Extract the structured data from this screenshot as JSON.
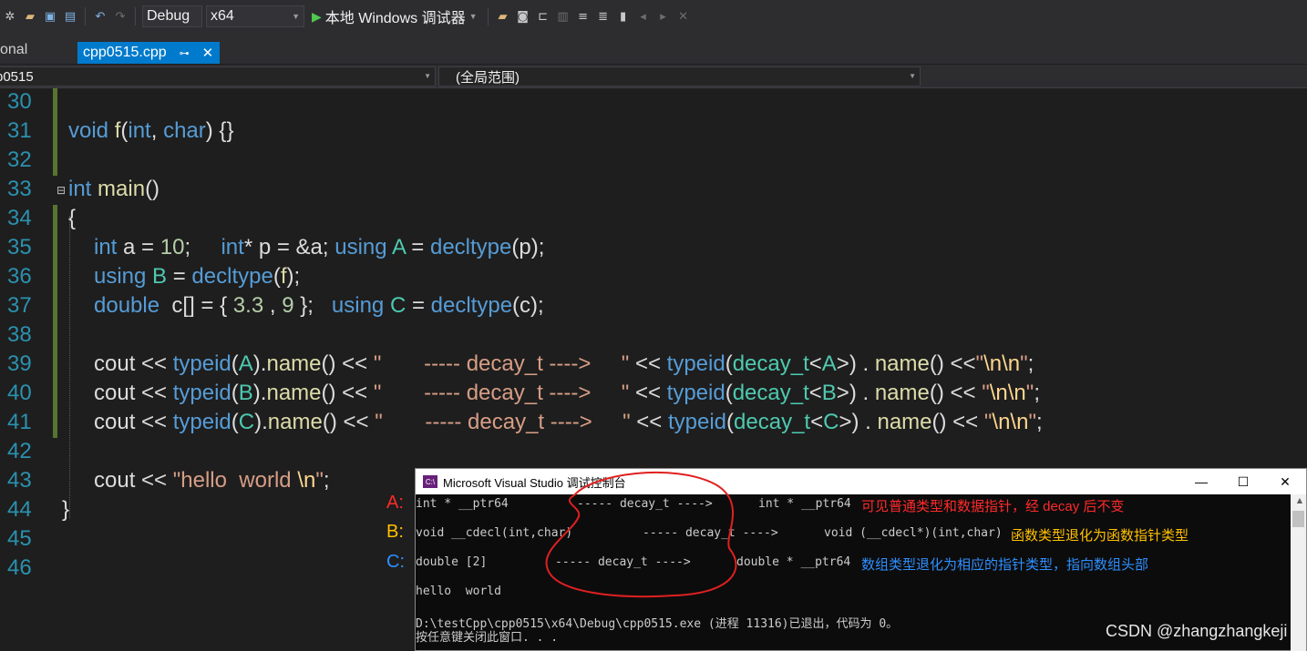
{
  "toolbar": {
    "config": "Debug",
    "platform": "x64",
    "run_label": "本地 Windows 调试器"
  },
  "tabs": {
    "inactive_label": "onal",
    "active_label": "cpp0515.cpp"
  },
  "navbar": {
    "project_scope": "p0515",
    "member_scope": "(全局范围)"
  },
  "line_numbers": [
    "30",
    "31",
    "32",
    "33",
    "34",
    "35",
    "36",
    "37",
    "38",
    "39",
    "40",
    "41",
    "42",
    "43",
    "44",
    "45",
    "46"
  ],
  "console": {
    "title": "Microsoft Visual Studio 调试控制台",
    "line_a": "int * __ptr64",
    "arrow": "----- decay_t ---->",
    "line_a_result": "int * __ptr64",
    "line_b": "void __cdecl(int,char)",
    "line_b_result": "void (__cdecl*)(int,char)",
    "line_c": "double [2]",
    "line_c_result": "double * __ptr64",
    "hello": "hello  world",
    "exit_line": "D:\\testCpp\\cpp0515\\x64\\Debug\\cpp0515.exe (进程 11316)已退出，代码为 0。",
    "press_key": "按任意键关闭此窗口. . ."
  },
  "annotations": {
    "label_a": "A:",
    "label_b": "B:",
    "label_c": "C:",
    "note_a": "可见普通类型和数据指针，经 decay 后不变",
    "note_b": "函数类型退化为函数指针类型",
    "note_c": "数组类型退化为相应的指针类型，指向数组头部",
    "color_a": "#ff2a2a",
    "color_b": "#ffc000",
    "color_c": "#2e8fff"
  },
  "watermark": "CSDN @zhangzhangkeji"
}
